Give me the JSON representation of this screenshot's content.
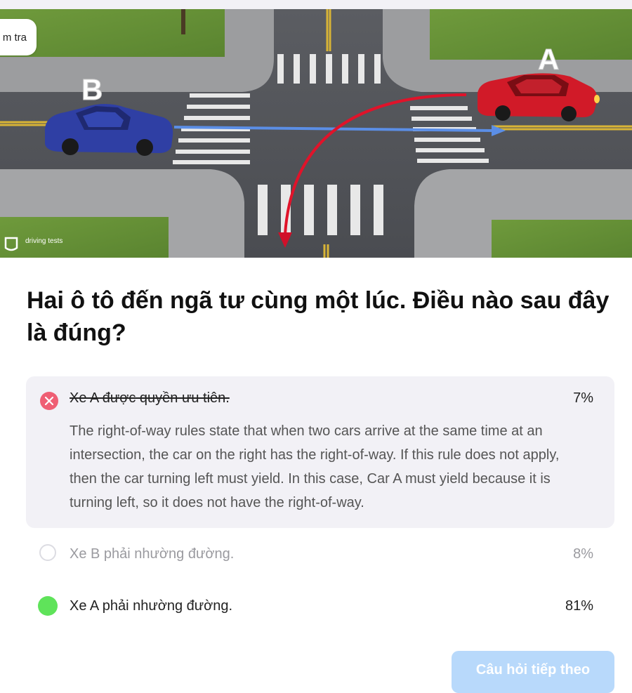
{
  "header": {
    "check_label": "m tra"
  },
  "hero": {
    "car_a_label": "A",
    "car_b_label": "B",
    "watermark": "driving tests"
  },
  "question": {
    "text": "Hai ô tô đến ngã tư cùng một lúc. Điều nào sau đây là đúng?"
  },
  "answers": [
    {
      "text": "Xe A được quyền ưu tiên.",
      "percent": "7%",
      "state": "wrong",
      "explanation": "The right-of-way rules state that when two cars arrive at the same time at an intersection, the car on the right has the right-of-way. If this rule does not apply, then the car turning left must yield. In this case, Car A must yield because it is turning left, so it does not have the right-of-way."
    },
    {
      "text": "Xe B phải nhường đường.",
      "percent": "8%",
      "state": "unselected"
    },
    {
      "text": "Xe A phải nhường đường.",
      "percent": "81%",
      "state": "correct"
    }
  ],
  "footer": {
    "next_label": "Câu hỏi tiếp theo"
  },
  "colors": {
    "wrong": "#ef5f74",
    "correct": "#5fe35a",
    "button": "#b8d9fb",
    "panel": "#f2f1f6"
  },
  "icons": [
    "wrong-x-icon",
    "radio-empty-icon",
    "radio-correct-icon",
    "driving-tests-logo-icon"
  ]
}
